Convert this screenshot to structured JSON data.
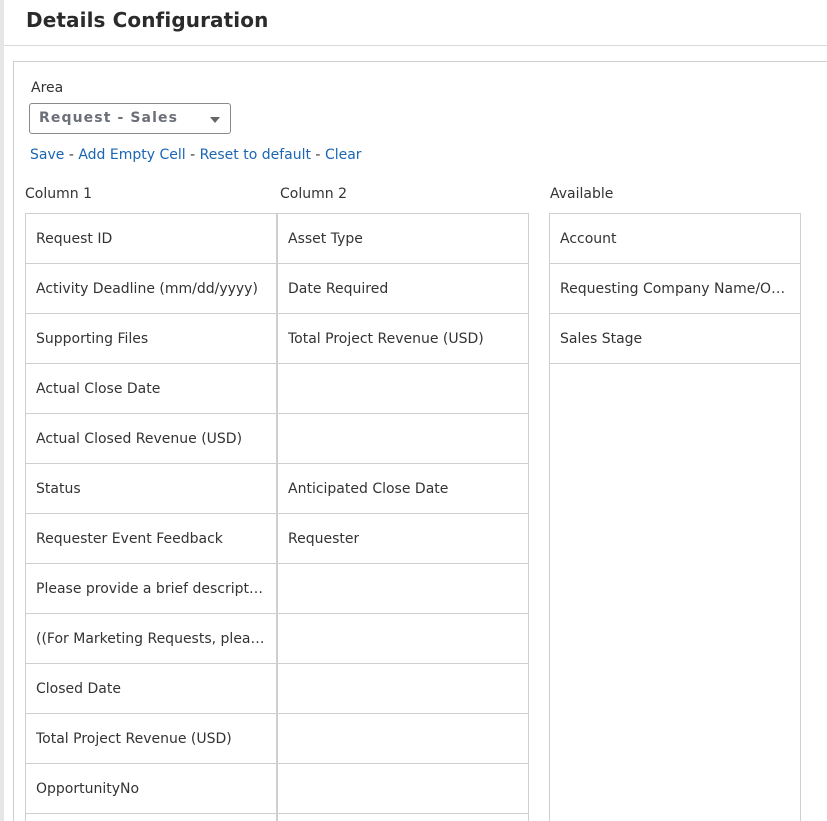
{
  "header": {
    "title": "Details Configuration"
  },
  "area": {
    "label": "Area",
    "selected": "Request - Sales"
  },
  "actions": {
    "save": "Save",
    "add_empty_cell": "Add Empty Cell",
    "reset_to_default": "Reset to default",
    "clear": "Clear",
    "separator": "-"
  },
  "columns": {
    "column1": {
      "title": "Column 1",
      "items": [
        "Request ID",
        "Activity Deadline (mm/dd/yyyy)",
        "Supporting Files",
        "Actual Close Date",
        "Actual Closed Revenue (USD)",
        "Status",
        "Requester Event Feedback",
        "Please provide a brief description…",
        "((For Marketing Requests, please …",
        "Closed Date",
        "Total Project Revenue (USD)",
        "OpportunityNo"
      ]
    },
    "column2": {
      "title": "Column 2",
      "items": [
        "Asset Type",
        "Date Required",
        "Total Project Revenue (USD)",
        "",
        "",
        "Anticipated Close Date",
        "Requester",
        "",
        "",
        "",
        "",
        ""
      ]
    },
    "available": {
      "title": "Available",
      "items": [
        "Account",
        "Requesting Company Name/Opp…",
        "Sales Stage"
      ]
    }
  },
  "colors": {
    "link": "#1a66b5",
    "border": "#cfcfcf",
    "text": "#333333"
  }
}
